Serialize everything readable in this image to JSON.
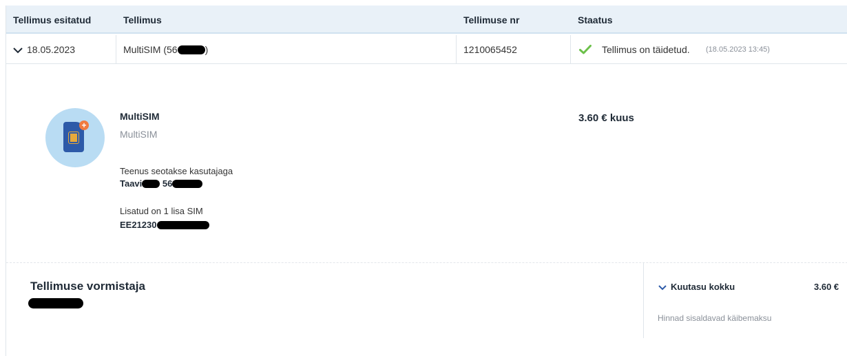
{
  "table": {
    "headers": [
      "Tellimus esitatud",
      "Tellimus",
      "Tellimuse nr",
      "Staatus"
    ],
    "row": {
      "date": "18.05.2023",
      "order_name": "MultiSIM (56",
      "order_name_suffix": ")",
      "order_number": "1210065452",
      "status_text": "Tellimus on täidetud.",
      "status_time": "(18.05.2023 13:45)"
    }
  },
  "details": {
    "product_title": "MultiSIM",
    "product_subtitle": "MultiSIM",
    "price": "3.60 € kuus",
    "service_label": "Teenus seotakse kasutajaga",
    "service_user_a": "Taavi",
    "service_user_b": "56",
    "sim_label": "Lisatud on 1 lisa SIM",
    "sim_value": "EE21230"
  },
  "footer": {
    "creator_title": "Tellimuse vormistaja",
    "monthly_total_label": "Kuutasu kokku",
    "monthly_total_value": "3.60 €",
    "vat_note": "Hinnad sisaldavad käibemaksu"
  },
  "colors": {
    "header_bg": "#e9f1f8",
    "check_green": "#6cc04a",
    "avatar_bg": "#b9dcf3",
    "sim_blue": "#2d5aa8",
    "accent_orange": "#f07b3f"
  },
  "icons": [
    "chevron-down-icon",
    "checkmark-icon",
    "multisim-icon",
    "chevron-down-icon"
  ]
}
